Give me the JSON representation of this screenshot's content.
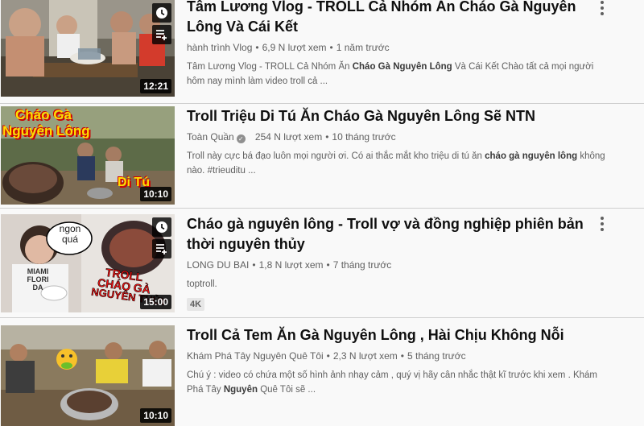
{
  "videos": [
    {
      "title": "Tâm Lương Vlog - TROLL Cả Nhóm Ăn Cháo Gà Nguyên Lông Và Cái Kết",
      "channel": "hành trình Vlog",
      "views": "6,9 N lượt xem",
      "age": "1 năm trước",
      "desc_a": "Tâm Lương Vlog - TROLL Cả Nhóm Ăn ",
      "desc_b": "Cháo Gà Nguyên Lông",
      "desc_c": " Và Cái Kết Chào tất cả mọi người hôm nay mình làm video troll cả ...",
      "duration": "12:21"
    },
    {
      "title": "Troll Triệu Di Tú Ăn Cháo Gà Nguyên Lông Sẽ NTN",
      "channel": "Toàn Quần",
      "views": "254 N lượt xem",
      "age": "10 tháng trước",
      "desc_a": "Troll này cực bá đạo luôn mọi người ơi. Có ai thắc mắt kho triệu di tú ăn ",
      "desc_b": "cháo gà nguyên lông",
      "desc_c": " không nào. #trieuditu ...",
      "duration": "10:10",
      "thumb_text_1": "Cháo Gà",
      "thumb_text_2": "Nguyên Lông",
      "thumb_text_3": "Di Tú"
    },
    {
      "title": "Cháo gà nguyên lông - Troll vợ và đồng nghiệp phiên bản thời nguyên thủy",
      "channel": "LONG DU BAI",
      "views": "1,8 N lượt xem",
      "age": "7 tháng trước",
      "desc_a": "toptroll.",
      "badge": "4K",
      "duration": "15:00",
      "thumb_bubble_1": "ngon",
      "thumb_bubble_2": "quá",
      "thumb_text_1": "TROLL",
      "thumb_text_2": "CHÁO GÀ",
      "thumb_text_3": "NGUYÊN THỦY",
      "shirt_1": "MIAMI",
      "shirt_2": "FLORI",
      "shirt_3": "DA"
    },
    {
      "title": "Troll Cả Tem Ăn Gà Nguyên Lông , Hài Chịu Không Nỗi",
      "channel": "Khám Phá Tây Nguyên Quê Tôi",
      "views": "2,3 N lượt xem",
      "age": "5 tháng trước",
      "desc_a": "Chú ý : video có chứa một số hình ảnh nhạy cảm , quý vị hãy cân nhắc thật kĩ trước khi xem . Khám Phá Tây ",
      "desc_b": "Nguyên",
      "desc_c": " Quê Tôi sẽ ...",
      "duration": "10:10"
    }
  ],
  "icons": {
    "clock": "clock-icon",
    "queue": "add-to-queue-icon",
    "more": "more-vert-icon",
    "verified": "verified-check-icon"
  }
}
